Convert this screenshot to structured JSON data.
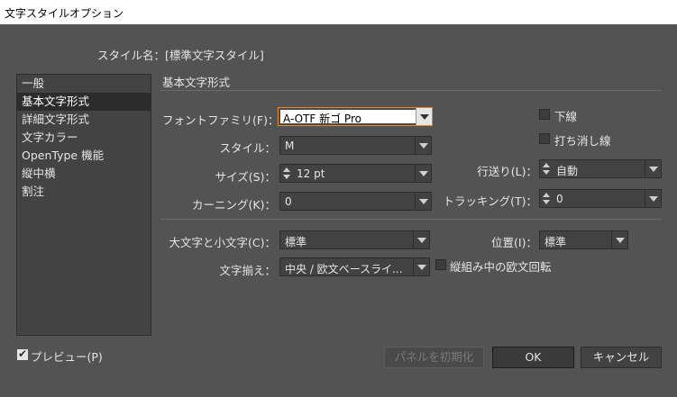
{
  "window": {
    "title": "文字スタイルオプション"
  },
  "style_name": {
    "label": "スタイル名：",
    "value": "[標準文字スタイル]"
  },
  "sidebar": {
    "items": [
      {
        "label": "一般"
      },
      {
        "label": "基本文字形式"
      },
      {
        "label": "詳細文字形式"
      },
      {
        "label": "文字カラー"
      },
      {
        "label": "OpenType 機能"
      },
      {
        "label": "縦中横"
      },
      {
        "label": "割注"
      }
    ],
    "selected_index": 1
  },
  "section": {
    "title": "基本文字形式"
  },
  "fields": {
    "font_family": {
      "label": "フォントファミリ(F)：",
      "value": "A-OTF 新ゴ Pro"
    },
    "style": {
      "label": "スタイル：",
      "value": "M"
    },
    "size": {
      "label": "サイズ(S)：",
      "value": "12 pt"
    },
    "kerning": {
      "label": "カーニング(K)：",
      "value": "0"
    },
    "leading": {
      "label": "行送り(L)：",
      "value": "自動"
    },
    "tracking": {
      "label": "トラッキング(T)：",
      "value": "0"
    },
    "case": {
      "label": "大文字と小文字(C)：",
      "value": "標準"
    },
    "position": {
      "label": "位置(I)：",
      "value": "標準"
    },
    "alignment": {
      "label": "文字揃え：",
      "value": "中央 / 欧文ベースライ..."
    }
  },
  "checkboxes": {
    "underline": {
      "label": "下線",
      "checked": false
    },
    "strikethrough": {
      "label": "打ち消し線",
      "checked": false
    },
    "tatechuyoko_roman": {
      "label": "縦組み中の欧文回転",
      "checked": false
    },
    "preview": {
      "label": "プレビュー(P)",
      "checked": true
    }
  },
  "buttons": {
    "reset": "パネルを初期化",
    "ok": "OK",
    "cancel": "キャンセル"
  }
}
